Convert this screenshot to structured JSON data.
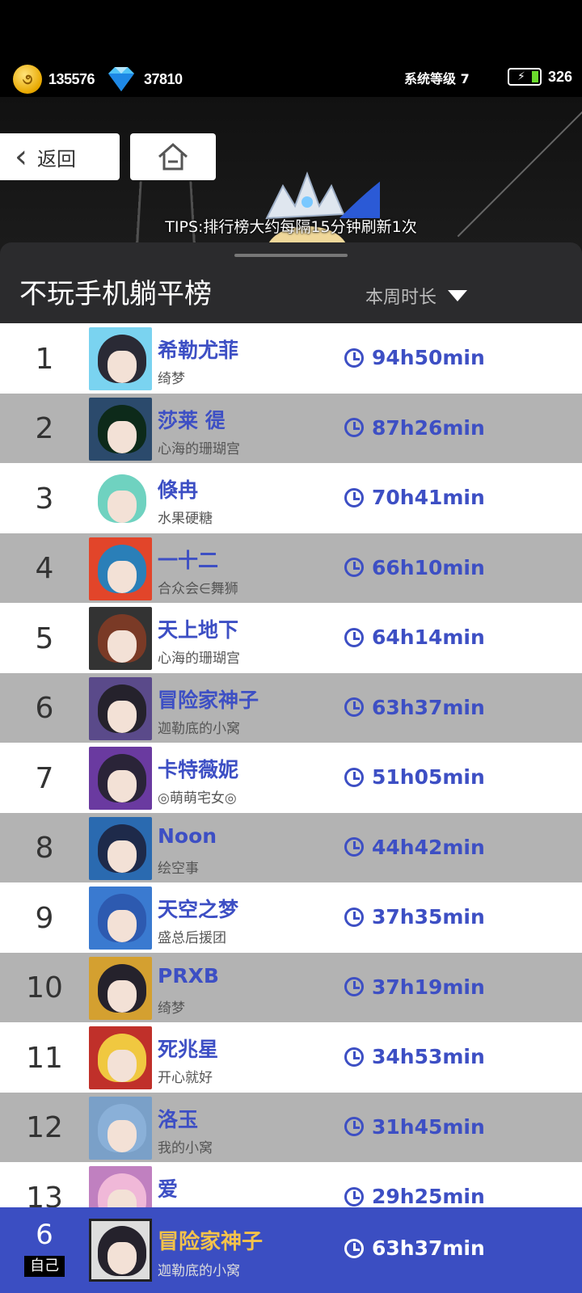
{
  "status": {
    "coins": "135576",
    "gems": "37810",
    "system_level": "系统等级 7",
    "energy": "326"
  },
  "nav": {
    "back_label": "返回",
    "tips": "TIPS:排行榜大约每隔15分钟刷新1次"
  },
  "panel": {
    "title": "不玩手机躺平榜",
    "period": "本周时长"
  },
  "rows": [
    {
      "rank": "1",
      "name": "希勒尤菲",
      "guild": "绮梦",
      "time": "94h50min",
      "hair": "#2a2a35",
      "frame": "#7ad3f0"
    },
    {
      "rank": "2",
      "name": "莎莱 徥",
      "guild": "心海的珊瑚宫",
      "time": "87h26min",
      "hair": "#0d2a1a",
      "frame": "#2b4a6c"
    },
    {
      "rank": "3",
      "name": "倏冉",
      "guild": "水果硬糖",
      "time": "70h41min",
      "hair": "#6fd2c0",
      "frame": "#ffffff"
    },
    {
      "rank": "4",
      "name": "一十二",
      "guild": "合众会∈舞狮",
      "time": "66h10min",
      "hair": "#2a7fb8",
      "frame": "#e2452a"
    },
    {
      "rank": "5",
      "name": "天上地下",
      "guild": "心海的珊瑚宫",
      "time": "64h14min",
      "hair": "#7a3a26",
      "frame": "#333333"
    },
    {
      "rank": "6",
      "name": "冒险家神子",
      "guild": "迦勒底的小窝",
      "time": "63h37min",
      "hair": "#25222c",
      "frame": "#5a4a8a"
    },
    {
      "rank": "7",
      "name": "卡特薇妮",
      "guild": "◎萌萌宅女◎",
      "time": "51h05min",
      "hair": "#2a2438",
      "frame": "#6a3aa0"
    },
    {
      "rank": "8",
      "name": "Noon",
      "guild": "绘空事",
      "time": "44h42min",
      "hair": "#1e2a4a",
      "frame": "#2a6ab0"
    },
    {
      "rank": "9",
      "name": "天空之梦",
      "guild": "盛总后援团",
      "time": "37h35min",
      "hair": "#2d5ab0",
      "frame": "#3a7ad0"
    },
    {
      "rank": "10",
      "name": "PRXB",
      "guild": "绮梦",
      "time": "37h19min",
      "hair": "#25222c",
      "frame": "#d4a030"
    },
    {
      "rank": "11",
      "name": "死兆星",
      "guild": "开心就好",
      "time": "34h53min",
      "hair": "#f0c840",
      "frame": "#c0302a"
    },
    {
      "rank": "12",
      "name": "洛玉",
      "guild": "我的小窝",
      "time": "31h45min",
      "hair": "#8ab0d8",
      "frame": "#7aa0c8"
    },
    {
      "rank": "13",
      "name": "爱",
      "guild": "",
      "time": "29h25min",
      "hair": "#f0b8d8",
      "frame": "#c080c0"
    }
  ],
  "self": {
    "rank": "6",
    "tag": "自己",
    "name": "冒险家神子",
    "guild": "迦勒底的小窝",
    "time": "63h37min"
  },
  "colors": {
    "accent_blue": "#3d4fc4",
    "self_bar": "#3b4ec2",
    "self_name": "#f5c24a"
  }
}
